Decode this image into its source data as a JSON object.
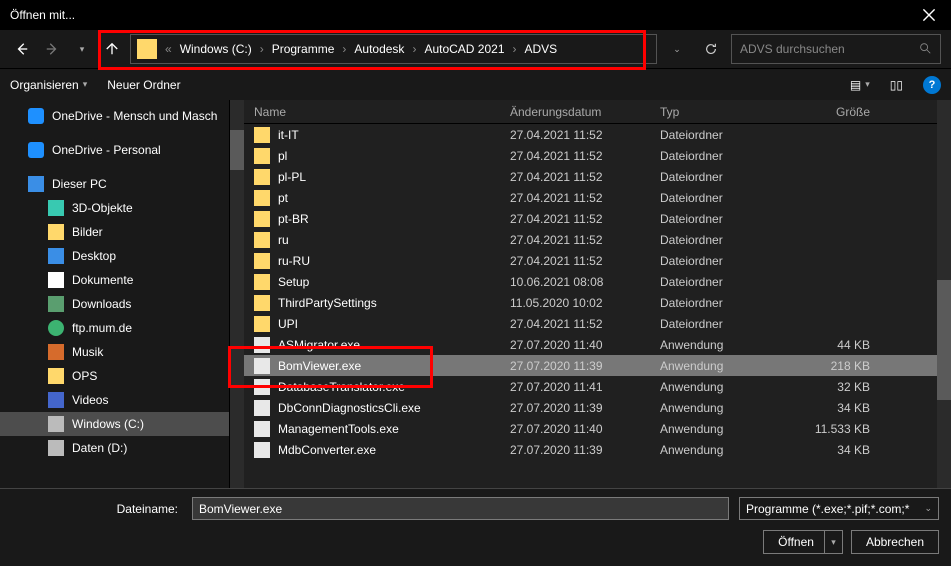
{
  "window": {
    "title": "Öffnen mit..."
  },
  "breadcrumb": {
    "prefix": "«",
    "root": "Windows (C:)",
    "p1": "Programme",
    "p2": "Autodesk",
    "p3": "AutoCAD 2021",
    "p4": "ADVS"
  },
  "search": {
    "placeholder": "ADVS durchsuchen"
  },
  "toolbar": {
    "organize": "Organisieren",
    "newfolder": "Neuer Ordner"
  },
  "columns": {
    "name": "Name",
    "date": "Änderungsdatum",
    "type": "Typ",
    "size": "Größe"
  },
  "sidebar": {
    "onedrive1": "OneDrive - Mensch und Masch",
    "onedrive2": "OneDrive - Personal",
    "thispc": "Dieser PC",
    "obj3d": "3D-Objekte",
    "pictures": "Bilder",
    "desktop": "Desktop",
    "documents": "Dokumente",
    "downloads": "Downloads",
    "ftp": "ftp.mum.de",
    "music": "Musik",
    "ops": "OPS",
    "videos": "Videos",
    "windowsc": "Windows (C:)",
    "datad": "Daten (D:)"
  },
  "rows": [
    {
      "name": "it-IT",
      "date": "27.04.2021 11:52",
      "type": "Dateiordner",
      "size": "",
      "icon": "ic-yf"
    },
    {
      "name": "pl",
      "date": "27.04.2021 11:52",
      "type": "Dateiordner",
      "size": "",
      "icon": "ic-yf"
    },
    {
      "name": "pl-PL",
      "date": "27.04.2021 11:52",
      "type": "Dateiordner",
      "size": "",
      "icon": "ic-yf"
    },
    {
      "name": "pt",
      "date": "27.04.2021 11:52",
      "type": "Dateiordner",
      "size": "",
      "icon": "ic-yf"
    },
    {
      "name": "pt-BR",
      "date": "27.04.2021 11:52",
      "type": "Dateiordner",
      "size": "",
      "icon": "ic-yf"
    },
    {
      "name": "ru",
      "date": "27.04.2021 11:52",
      "type": "Dateiordner",
      "size": "",
      "icon": "ic-yf"
    },
    {
      "name": "ru-RU",
      "date": "27.04.2021 11:52",
      "type": "Dateiordner",
      "size": "",
      "icon": "ic-yf"
    },
    {
      "name": "Setup",
      "date": "10.06.2021 08:08",
      "type": "Dateiordner",
      "size": "",
      "icon": "ic-yf"
    },
    {
      "name": "ThirdPartySettings",
      "date": "11.05.2020 10:02",
      "type": "Dateiordner",
      "size": "",
      "icon": "ic-yf"
    },
    {
      "name": "UPI",
      "date": "27.04.2021 11:52",
      "type": "Dateiordner",
      "size": "",
      "icon": "ic-yf"
    },
    {
      "name": "ASMigrator.exe",
      "date": "27.07.2020 11:40",
      "type": "Anwendung",
      "size": "44 KB",
      "icon": "ic-exe"
    },
    {
      "name": "BomViewer.exe",
      "date": "27.07.2020 11:39",
      "type": "Anwendung",
      "size": "218 KB",
      "icon": "ic-exe",
      "sel": true
    },
    {
      "name": "DatabaseTranslator.exe",
      "date": "27.07.2020 11:41",
      "type": "Anwendung",
      "size": "32 KB",
      "icon": "ic-exe"
    },
    {
      "name": "DbConnDiagnosticsCli.exe",
      "date": "27.07.2020 11:39",
      "type": "Anwendung",
      "size": "34 KB",
      "icon": "ic-exe"
    },
    {
      "name": "ManagementTools.exe",
      "date": "27.07.2020 11:40",
      "type": "Anwendung",
      "size": "11.533 KB",
      "icon": "ic-exe"
    },
    {
      "name": "MdbConverter.exe",
      "date": "27.07.2020 11:39",
      "type": "Anwendung",
      "size": "34 KB",
      "icon": "ic-exe"
    }
  ],
  "bottom": {
    "filename_label": "Dateiname:",
    "filename_value": "BomViewer.exe",
    "filter": "Programme (*.exe;*.pif;*.com;*",
    "open": "Öffnen",
    "cancel": "Abbrechen"
  }
}
